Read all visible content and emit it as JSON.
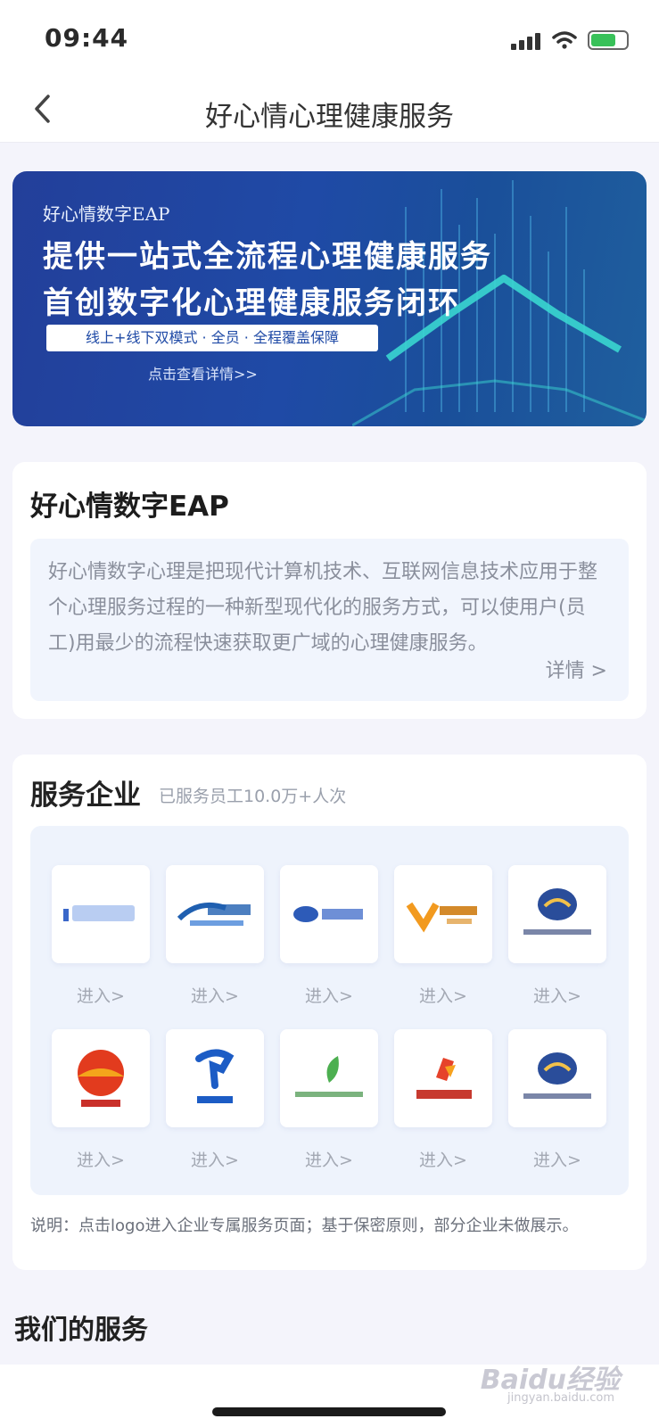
{
  "status_bar": {
    "time": "09:44"
  },
  "nav": {
    "title": "好心情心理健康服务"
  },
  "banner": {
    "small_title": "好心情数字EAP",
    "line1": "提供一站式全流程心理健康服务",
    "line2": "首创数字化心理健康服务闭环",
    "pill_text": "线上+线下双模式 · 全员 · 全程覆盖保障",
    "link_text": "点击查看详情>>"
  },
  "eap_card": {
    "title": "好心情数字EAP",
    "description": "好心情数字心理是把现代计算机技术、互联网信息技术应用于整个心理服务过程的一种新型现代化的服务方式，可以使用户(员工)用最少的流程快速获取更广域的心理健康服务。",
    "more_label": "详情 >"
  },
  "service_card": {
    "title": "服务企业",
    "subtitle": "已服务员工10.0万+人次",
    "enter_label": "进入>",
    "logos": [
      {
        "icon": "company-logo-blue-text"
      },
      {
        "icon": "company-logo-blue-arc"
      },
      {
        "icon": "company-logo-blue-oval"
      },
      {
        "icon": "company-logo-orange-v"
      },
      {
        "icon": "company-logo-navy-emblem"
      },
      {
        "icon": "company-logo-sunrise"
      },
      {
        "icon": "company-logo-telecom"
      },
      {
        "icon": "company-logo-green-leaf"
      },
      {
        "icon": "company-logo-red-orange"
      },
      {
        "icon": "company-logo-navy-emblem-2"
      }
    ],
    "note": "说明：点击logo进入企业专属服务页面；基于保密原则，部分企业未做展示。"
  },
  "section_ours": {
    "title": "我们的服务"
  },
  "watermark": {
    "main": "Baidu经验",
    "sub": "jingyan.baidu.com"
  },
  "colors": {
    "banner": "#1f4aa6",
    "accent_cyan": "#3ad6d0",
    "page_bg": "#f4f4fb"
  }
}
